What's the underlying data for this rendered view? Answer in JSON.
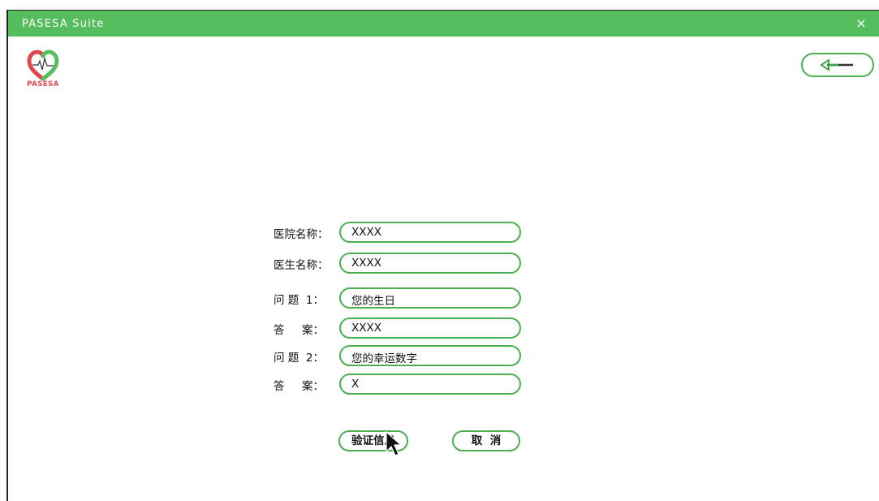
{
  "window": {
    "title": "PASESA Suite",
    "close_glyph": "×",
    "logo_text": "PASESA",
    "back_icon": "arrow-left-icon"
  },
  "form": {
    "fields": [
      {
        "label": "医院名称：",
        "value": "XXXX"
      },
      {
        "label": "医生名称：",
        "value": "XXXX"
      },
      {
        "label": "问 题  1：",
        "value": "您的生日"
      },
      {
        "label": "答     案：",
        "value": "XXXX"
      },
      {
        "label": "问 题  2：",
        "value": "您的幸运数字"
      },
      {
        "label": "答     案：",
        "value": "X"
      }
    ],
    "verify_label": "验证信息",
    "cancel_label": "取  消"
  },
  "colors": {
    "accent": "#56bd5e",
    "border": "#4caf50",
    "logo_red": "#e0464b"
  }
}
